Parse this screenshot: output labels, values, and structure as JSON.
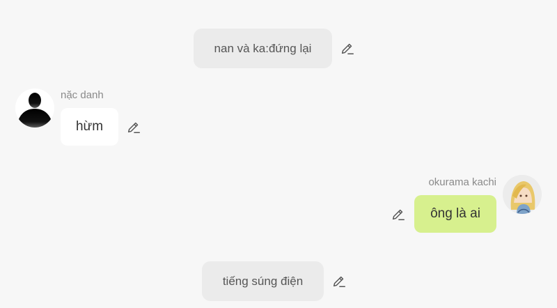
{
  "messages": [
    {
      "type": "narration",
      "text": "nan và ka:đứng lại"
    },
    {
      "type": "incoming",
      "sender": "nặc danh",
      "text": "hừm",
      "avatar_icon": "silhouette-avatar"
    },
    {
      "type": "outgoing",
      "sender": "okurama kachi",
      "text": "ông là ai",
      "avatar_icon": "anime-girl-avatar"
    },
    {
      "type": "narration",
      "text": "tiếng súng điện"
    }
  ],
  "colors": {
    "background": "#f7f7f7",
    "narration_bg": "#ebebeb",
    "incoming_bubble": "#ffffff",
    "outgoing_bubble": "#d7f08e",
    "name_text": "#8a8a8a"
  }
}
